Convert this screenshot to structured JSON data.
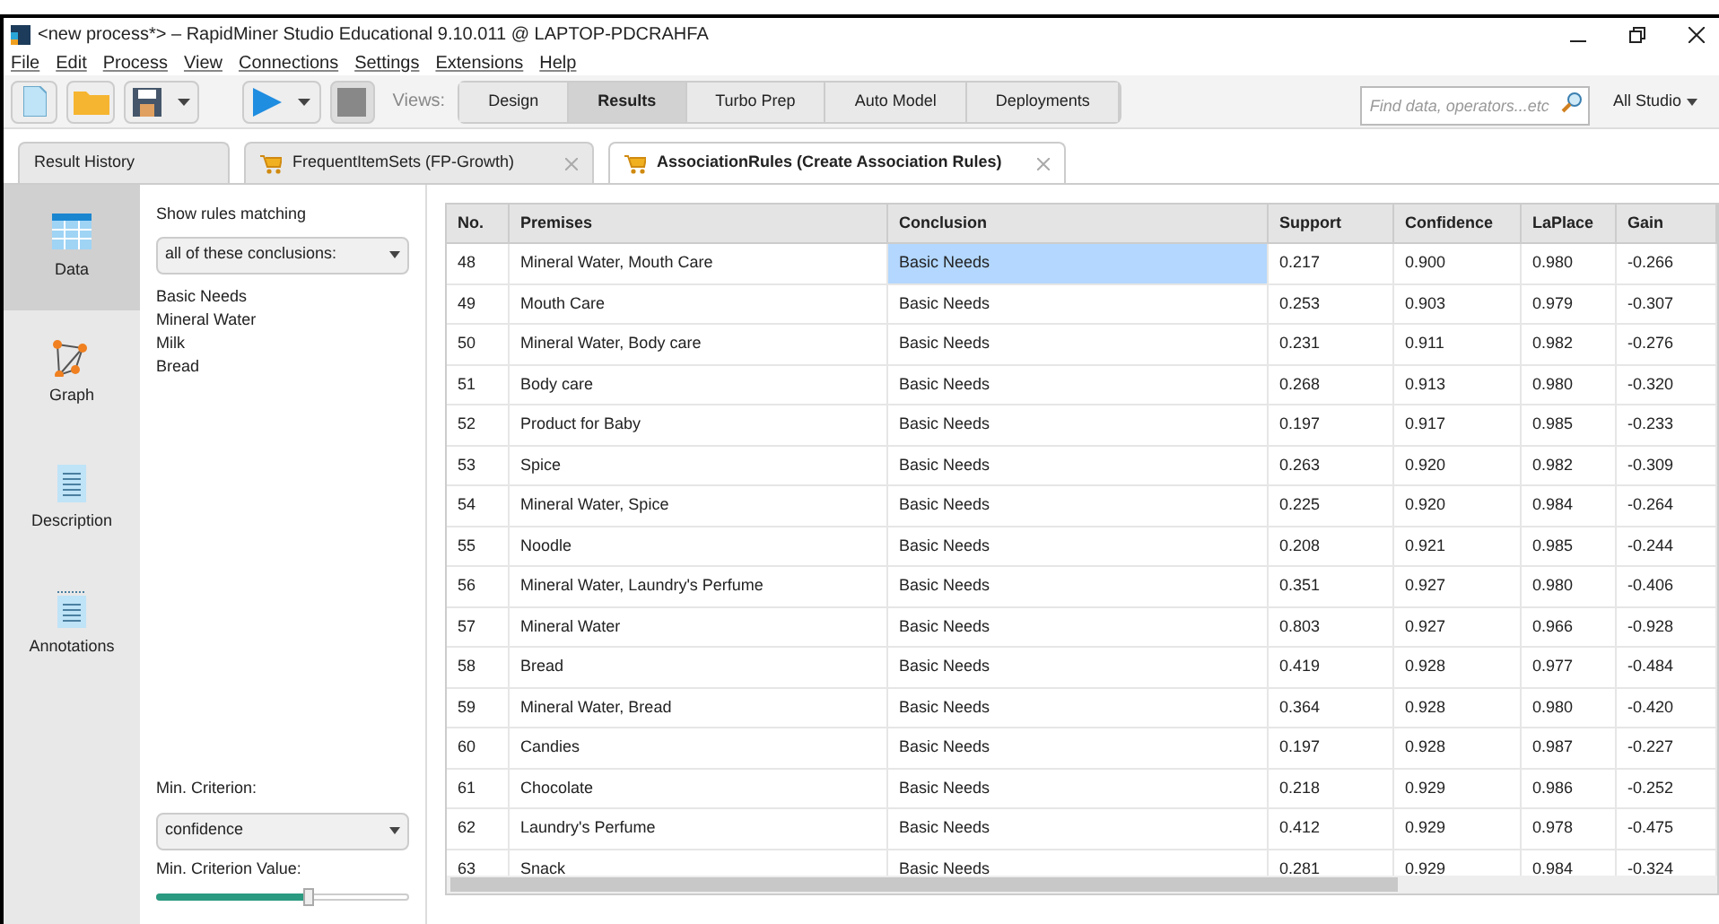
{
  "window": {
    "title": "<new process*> – RapidMiner Studio Educational 9.10.011 @ LAPTOP-PDCRAHFA"
  },
  "menu": [
    "File",
    "Edit",
    "Process",
    "View",
    "Connections",
    "Settings",
    "Extensions",
    "Help"
  ],
  "views_label": "Views:",
  "views": [
    {
      "label": "Design",
      "selected": false
    },
    {
      "label": "Results",
      "selected": true
    },
    {
      "label": "Turbo Prep",
      "selected": false
    },
    {
      "label": "Auto Model",
      "selected": false
    },
    {
      "label": "Deployments",
      "selected": false
    }
  ],
  "search": {
    "placeholder": "Find data, operators...etc"
  },
  "scope": "All Studio",
  "tabs": [
    {
      "label": "Result History",
      "kind": "plain",
      "selected": false
    },
    {
      "label": "FrequentItemSets (FP-Growth)",
      "kind": "closable",
      "selected": false
    },
    {
      "label": "AssociationRules (Create Association Rules)",
      "kind": "closable",
      "selected": true
    }
  ],
  "sidebar": {
    "items": [
      {
        "label": "Data",
        "kind": "table",
        "selected": true
      },
      {
        "label": "Graph",
        "kind": "graph",
        "selected": false
      },
      {
        "label": "Description",
        "kind": "doc",
        "selected": false
      },
      {
        "label": "Annotations",
        "kind": "notes",
        "selected": false
      }
    ]
  },
  "filter": {
    "title": "Show rules matching",
    "mode": "all of these conclusions:",
    "conclusions": [
      "Basic Needs",
      "Mineral Water",
      "Milk",
      "Bread"
    ],
    "criterion_label": "Min. Criterion:",
    "criterion": "confidence",
    "value_label": "Min. Criterion Value:",
    "level": 0.6
  },
  "table": {
    "columns": [
      "No.",
      "Premises",
      "Conclusion",
      "Support",
      "Confidence",
      "LaPlace",
      "Gain"
    ],
    "rows": [
      {
        "cells": [
          "48",
          "Mineral Water, Mouth Care",
          "Basic Needs",
          "0.217",
          "0.900",
          "0.980",
          "-0.266"
        ],
        "selected": true
      },
      {
        "cells": [
          "49",
          "Mouth Care",
          "Basic Needs",
          "0.253",
          "0.903",
          "0.979",
          "-0.307"
        ],
        "selected": false
      },
      {
        "cells": [
          "50",
          "Mineral Water, Body care",
          "Basic Needs",
          "0.231",
          "0.911",
          "0.982",
          "-0.276"
        ],
        "selected": false
      },
      {
        "cells": [
          "51",
          "Body care",
          "Basic Needs",
          "0.268",
          "0.913",
          "0.980",
          "-0.320"
        ],
        "selected": false
      },
      {
        "cells": [
          "52",
          "Product for Baby",
          "Basic Needs",
          "0.197",
          "0.917",
          "0.985",
          "-0.233"
        ],
        "selected": false
      },
      {
        "cells": [
          "53",
          "Spice",
          "Basic Needs",
          "0.263",
          "0.920",
          "0.982",
          "-0.309"
        ],
        "selected": false
      },
      {
        "cells": [
          "54",
          "Mineral Water, Spice",
          "Basic Needs",
          "0.225",
          "0.920",
          "0.984",
          "-0.264"
        ],
        "selected": false
      },
      {
        "cells": [
          "55",
          "Noodle",
          "Basic Needs",
          "0.208",
          "0.921",
          "0.985",
          "-0.244"
        ],
        "selected": false
      },
      {
        "cells": [
          "56",
          "Mineral Water, Laundry's Perfume",
          "Basic Needs",
          "0.351",
          "0.927",
          "0.980",
          "-0.406"
        ],
        "selected": false
      },
      {
        "cells": [
          "57",
          "Mineral Water",
          "Basic Needs",
          "0.803",
          "0.927",
          "0.966",
          "-0.928"
        ],
        "selected": false
      },
      {
        "cells": [
          "58",
          "Bread",
          "Basic Needs",
          "0.419",
          "0.928",
          "0.977",
          "-0.484"
        ],
        "selected": false
      },
      {
        "cells": [
          "59",
          "Mineral Water, Bread",
          "Basic Needs",
          "0.364",
          "0.928",
          "0.980",
          "-0.420"
        ],
        "selected": false
      },
      {
        "cells": [
          "60",
          "Candies",
          "Basic Needs",
          "0.197",
          "0.928",
          "0.987",
          "-0.227"
        ],
        "selected": false
      },
      {
        "cells": [
          "61",
          "Chocolate",
          "Basic Needs",
          "0.218",
          "0.929",
          "0.986",
          "-0.252"
        ],
        "selected": false
      },
      {
        "cells": [
          "62",
          "Laundry's Perfume",
          "Basic Needs",
          "0.412",
          "0.929",
          "0.978",
          "-0.475"
        ],
        "selected": false
      },
      {
        "cells": [
          "63",
          "Snack",
          "Basic Needs",
          "0.281",
          "0.929",
          "0.984",
          "-0.324"
        ],
        "selected": false
      }
    ]
  }
}
